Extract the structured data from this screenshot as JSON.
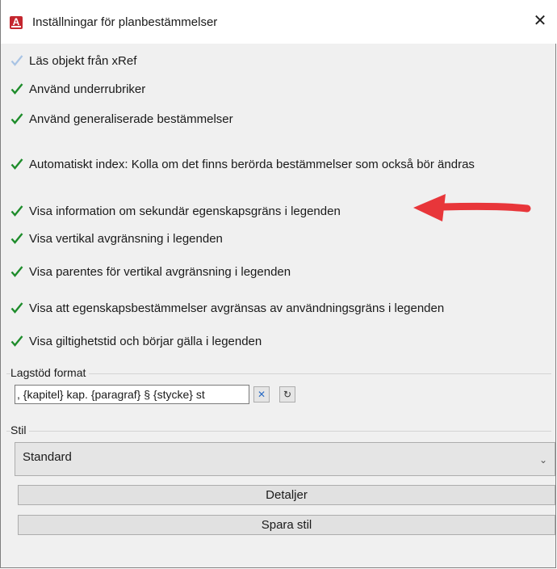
{
  "window": {
    "title": "Inställningar för planbestämmelser",
    "app_icon_letter": "A",
    "close_glyph": "✕"
  },
  "options": [
    {
      "label": "Läs objekt från xRef",
      "checked": true,
      "enabled": false
    },
    {
      "label": "Använd underrubriker",
      "checked": true,
      "enabled": true
    },
    {
      "label": "Använd generaliserade bestämmelser",
      "checked": true,
      "enabled": true
    },
    {
      "label": "Automatiskt index: Kolla om det finns berörda bestämmelser som också bör ändras",
      "checked": true,
      "enabled": true
    },
    {
      "label": "Visa information om sekundär egenskapsgräns i legenden",
      "checked": true,
      "enabled": true
    },
    {
      "label": "Visa vertikal avgränsning i legenden",
      "checked": true,
      "enabled": true
    },
    {
      "label": "Visa parentes för vertikal avgränsning i legenden",
      "checked": true,
      "enabled": true
    },
    {
      "label": "Visa att egenskapsbestämmelser avgränsas av användningsgräns i legenden",
      "checked": true,
      "enabled": true
    },
    {
      "label": "Visa giltighetstid och börjar gälla i legenden",
      "checked": true,
      "enabled": true
    }
  ],
  "lagstod": {
    "group_label": "Lagstöd format",
    "value": ", {kapitel} kap. {paragraf} § {stycke} st",
    "clear_glyph": "✕",
    "refresh_glyph": "↻"
  },
  "stil": {
    "group_label": "Stil",
    "selected": "Standard",
    "chevron_glyph": "⌄"
  },
  "buttons": {
    "details": "Detaljer",
    "save_style": "Spara stil"
  },
  "colors": {
    "check_green": "#1e8c2b",
    "check_disabled": "#a9c4e4",
    "arrow_red": "#e8363a",
    "app_icon_red": "#c4262e"
  },
  "icons": {
    "check": "checkmark-icon",
    "arrow": "arrow-left-annotation-icon"
  }
}
